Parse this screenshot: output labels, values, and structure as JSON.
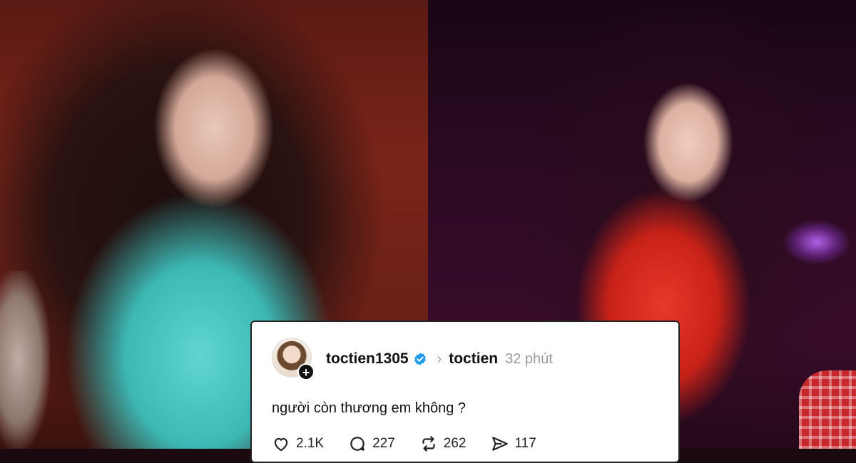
{
  "post": {
    "username": "toctien1305",
    "community": "toctien",
    "time": "32 phút",
    "text": "người còn thương em không ?",
    "stats": {
      "likes": "2.1K",
      "replies": "227",
      "reposts": "262",
      "shares": "117"
    }
  },
  "icons": {
    "verified": "verified-badge-icon",
    "follow": "plus-icon",
    "separator": "chevron-right-icon",
    "like": "heart-icon",
    "reply": "comment-icon",
    "repost": "repost-icon",
    "share": "send-icon"
  },
  "colors": {
    "verified": "#1d9bf0",
    "card_background": "#ffffff",
    "muted_text": "#999999"
  }
}
